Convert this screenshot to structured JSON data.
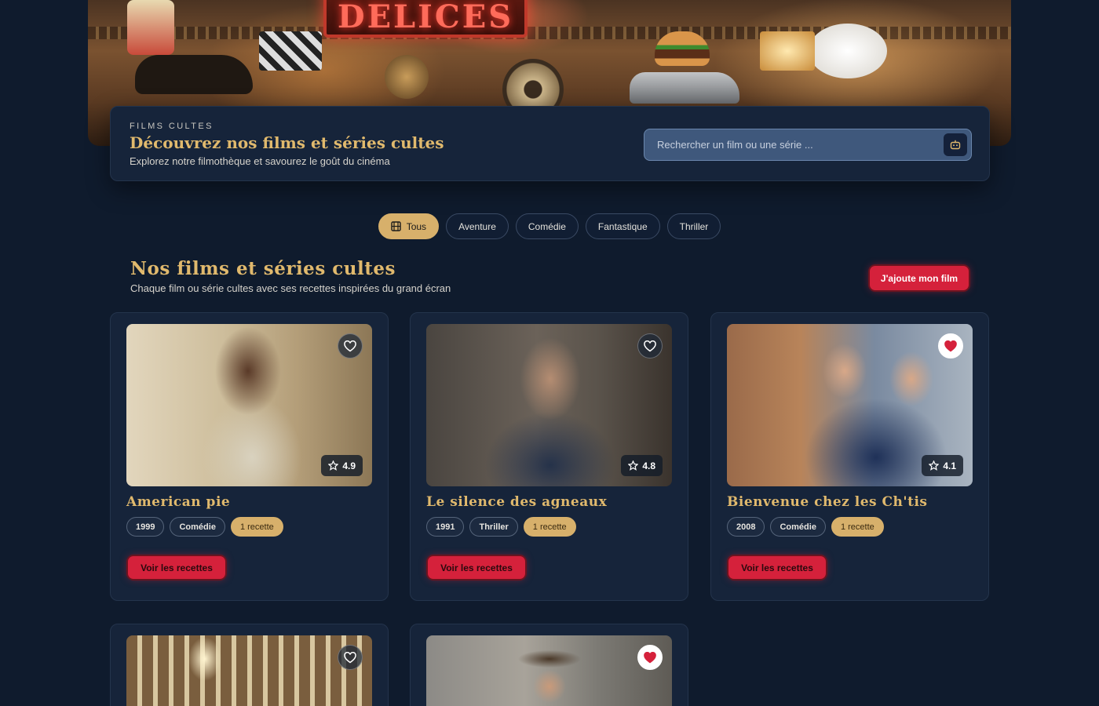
{
  "hero": {
    "sign_text": "DELICES"
  },
  "intro": {
    "kicker": "FILMS CULTES",
    "title": "Découvrez nos films et séries cultes",
    "subtitle": "Explorez notre filmothèque et savourez le goût du cinéma",
    "search_placeholder": "Rechercher un film ou une série ...",
    "search_icon": "robot-icon"
  },
  "filters": [
    {
      "label": "Tous",
      "active": true,
      "icon": "film-icon"
    },
    {
      "label": "Aventure",
      "active": false
    },
    {
      "label": "Comédie",
      "active": false
    },
    {
      "label": "Fantastique",
      "active": false
    },
    {
      "label": "Thriller",
      "active": false
    }
  ],
  "section": {
    "title": "Nos films et séries cultes",
    "subtitle": "Chaque film ou série cultes avec ses recettes inspirées du grand écran",
    "add_button": "J'ajoute mon film"
  },
  "movies": [
    {
      "title": "American pie",
      "year": "1999",
      "genre": "Comédie",
      "recipes": "1 recette",
      "rating": "4.9",
      "favorite": false,
      "button": "Voir les recettes"
    },
    {
      "title": "Le silence des agneaux",
      "year": "1991",
      "genre": "Thriller",
      "recipes": "1 recette",
      "rating": "4.8",
      "favorite": false,
      "button": "Voir les recettes"
    },
    {
      "title": "Bienvenue chez les Ch'tis",
      "year": "2008",
      "genre": "Comédie",
      "recipes": "1 recette",
      "rating": "4.1",
      "favorite": true,
      "button": "Voir les recettes"
    },
    {
      "favorite": false
    },
    {
      "favorite": true
    }
  ],
  "colors": {
    "accent_gold": "#d7b06b",
    "title_gold": "#e0b96d",
    "button_red": "#d5213b",
    "background": "#0f1b2d",
    "card": "#16243a"
  }
}
